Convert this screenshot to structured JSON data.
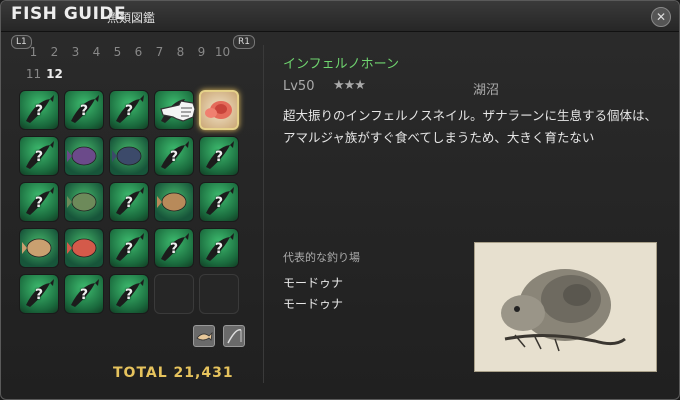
{
  "window": {
    "title": "FISH GUIDE",
    "subtitle": "魚類図鑑"
  },
  "nav": {
    "l1": "L1",
    "r1": "R1",
    "pages_row1": [
      "1",
      "2",
      "3",
      "4",
      "5",
      "6",
      "7",
      "8",
      "9",
      "10"
    ],
    "pages_row2": [
      "11",
      "12"
    ],
    "active_page": "12"
  },
  "grid": {
    "cells": [
      "unknown",
      "unknown",
      "unknown",
      "cursor",
      "selected",
      "unknown",
      "caught",
      "caught",
      "unknown",
      "unknown",
      "unknown",
      "caught",
      "unknown",
      "caught",
      "unknown",
      "caught",
      "caught",
      "unknown",
      "unknown",
      "unknown",
      "unknown",
      "unknown",
      "unknown",
      "empty",
      "empty"
    ],
    "unknown_mark": "?"
  },
  "footer": {
    "total_label": "TOTAL 21,431"
  },
  "detail": {
    "name": "インフェルノホーン",
    "level": "Lv50",
    "stars": "★★★",
    "habitat": "湖沼",
    "description": "超大振りのインフェルノスネイル。ザナラーンに生息する個体は、アマルジャ族がすぐ食べてしまうため、大きく育たない",
    "spot_title": "代表的な釣り場",
    "spots": [
      "モードゥナ",
      "モードゥナ"
    ]
  },
  "icons": {
    "close": "close-icon",
    "fish": "fish-silhouette-icon",
    "tools": [
      "fish-sort-icon",
      "fishing-rod-icon"
    ]
  },
  "colors": {
    "accent_gold": "#e6c35d",
    "name_green": "#6fd46f",
    "cell_green": "#2f9a57"
  }
}
